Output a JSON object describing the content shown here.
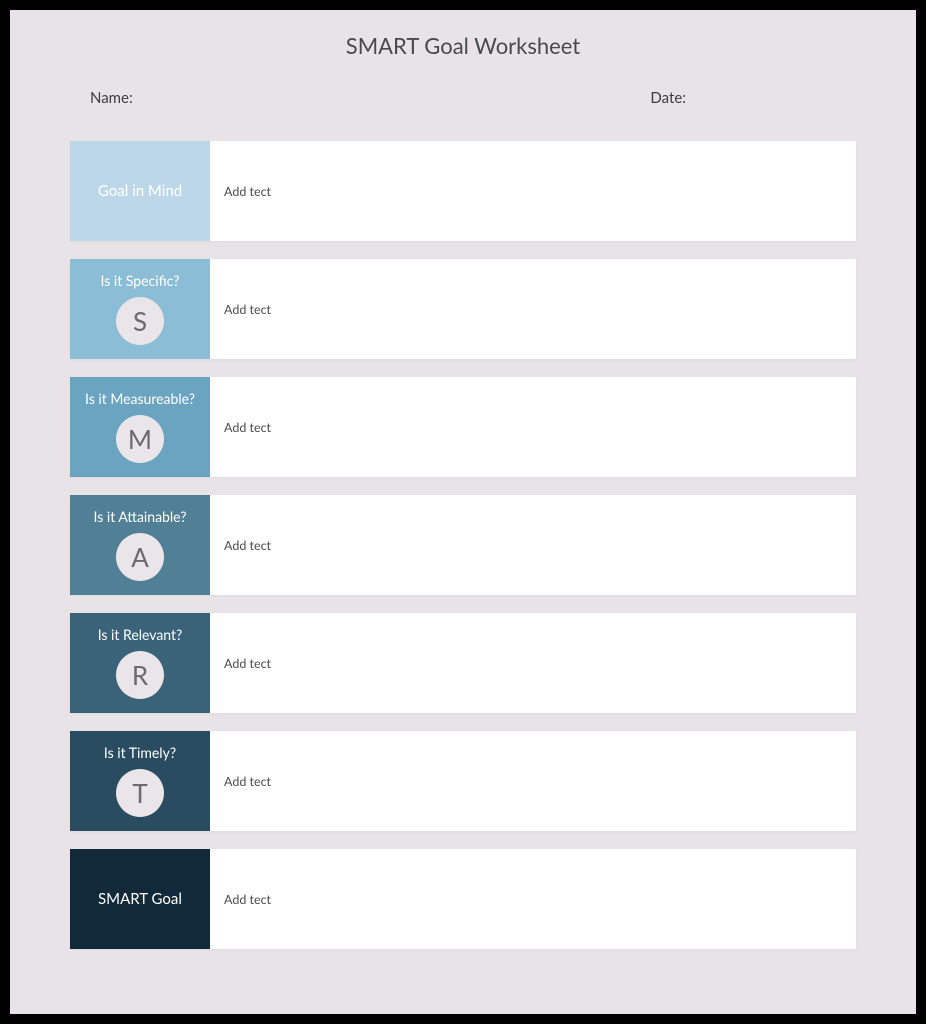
{
  "title": "SMART Goal Worksheet",
  "meta": {
    "name_label": "Name:",
    "date_label": "Date:"
  },
  "placeholder": "Add tect",
  "rows": [
    {
      "label": "Goal in Mind",
      "letter": "",
      "color": "c0"
    },
    {
      "label": "Is it Specific?",
      "letter": "S",
      "color": "c1"
    },
    {
      "label": "Is it Measureable?",
      "letter": "M",
      "color": "c2"
    },
    {
      "label": "Is it Attainable?",
      "letter": "A",
      "color": "c3"
    },
    {
      "label": "Is it Relevant?",
      "letter": "R",
      "color": "c4"
    },
    {
      "label": "Is it Timely?",
      "letter": "T",
      "color": "c5"
    },
    {
      "label": "SMART Goal",
      "letter": "",
      "color": "c6"
    }
  ]
}
